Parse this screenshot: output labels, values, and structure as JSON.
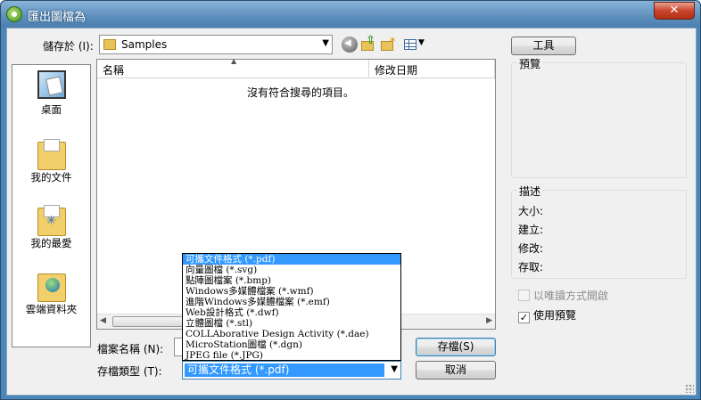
{
  "window": {
    "title": "匯出圖檔為",
    "close_symbol": "✕"
  },
  "toolbar": {
    "save_in_label": "儲存於 (I):",
    "folder": "Samples"
  },
  "places": [
    {
      "label": "桌面",
      "icon": "desktop-icon"
    },
    {
      "label": "我的文件",
      "icon": "my-documents-icon"
    },
    {
      "label": "我的最愛",
      "icon": "favorites-icon"
    },
    {
      "label": "雲端資料夾",
      "icon": "cloud-folder-icon"
    }
  ],
  "file_list": {
    "columns": [
      "名稱",
      "修改日期"
    ],
    "empty_message": "沒有符合搜尋的項目。"
  },
  "right_panel": {
    "tools_button": "工具",
    "preview_title": "預覽",
    "description_title": "描述",
    "fields": [
      "大小:",
      "建立:",
      "修改:",
      "存取:"
    ],
    "readonly_label": "以唯讀方式開啟",
    "readonly_checked": false,
    "use_preview_label": "使用預覽",
    "use_preview_checked": true,
    "check_mark": "✓"
  },
  "bottom": {
    "filename_label": "檔案名稱 (N):",
    "filename_value": "",
    "filetype_label": "存檔類型 (T):",
    "filetype_value": "可攜文件格式 (*.pdf)",
    "save_button": "存檔(S)",
    "cancel_button": "取消"
  },
  "filetype_options": [
    "可攜文件格式 (*.pdf)",
    "向量圖檔 (*.svg)",
    "點陣圖檔案 (*.bmp)",
    "Windows多媒體檔案 (*.wmf)",
    "進階Windows多媒體檔案 (*.emf)",
    "Web設計格式 (*.dwf)",
    "立體圖檔 (*.stl)",
    "COLLAborative Design Activity (*.dae)",
    "MicroStation圖檔 (*.dgn)",
    "JPEG file (*.JPG)"
  ],
  "colors": {
    "selection": "#3399ff",
    "title_bar": "#5d8fbd"
  }
}
